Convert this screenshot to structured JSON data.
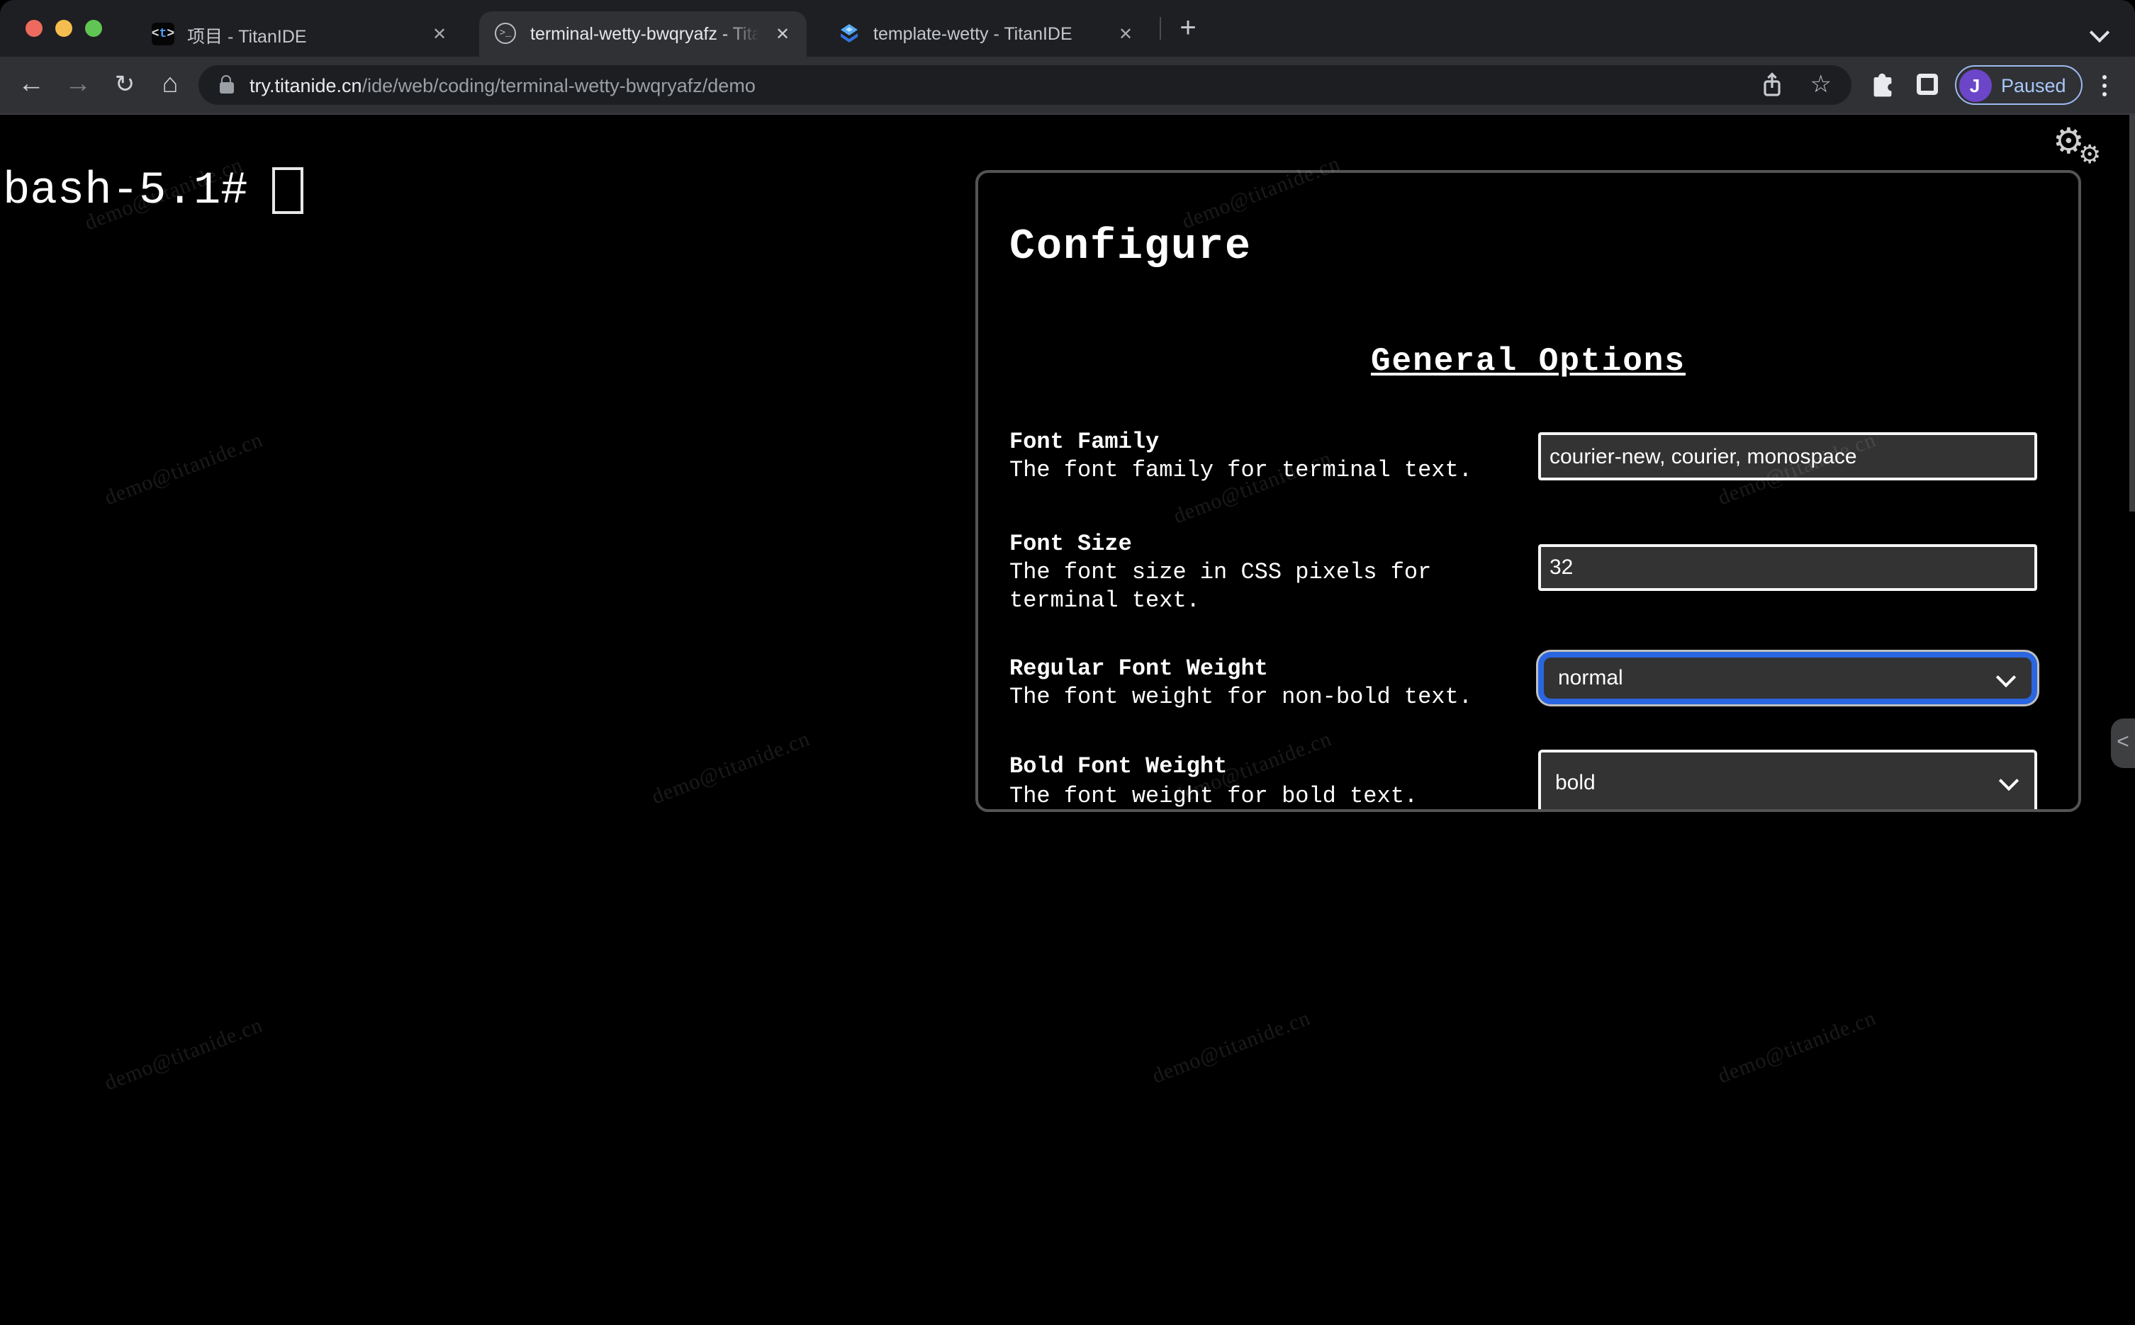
{
  "browser": {
    "tabs": [
      {
        "title": "项目 - TitanIDE",
        "active": false
      },
      {
        "title": "terminal-wetty-bwqryafz - Tita",
        "active": true
      },
      {
        "title": "template-wetty - TitanIDE",
        "active": false
      }
    ],
    "url": {
      "host": "try.titanide.cn",
      "path": "/ide/web/coding/terminal-wetty-bwqryafz/demo"
    },
    "profile": {
      "initial": "J",
      "status": "Paused"
    },
    "icons": {
      "close": "✕",
      "new_tab": "+",
      "back": "←",
      "forward": "→",
      "reload": "↻",
      "home": "⌂",
      "star": "☆",
      "gear": "⚙",
      "collapse": "<",
      "favicon_bracket_l": "<",
      "favicon_t": "t",
      "favicon_bracket_r": ">",
      "favicon_terminal": ">_"
    },
    "colors": {
      "accent_blue": "#2a66e0",
      "profile_purple": "#6b46c8",
      "paused_blue": "#a8c7fa",
      "traffic_red": "#ee6a5e",
      "traffic_yellow": "#f5bd4f",
      "traffic_green": "#61c554",
      "tabstrip_bg": "#1e1f22",
      "toolbar_bg": "#303134",
      "page_bg": "#000000"
    }
  },
  "terminal": {
    "prompt": "bash-5.1#"
  },
  "watermark": {
    "text": "demo@titanide.cn"
  },
  "configure": {
    "title": "Configure",
    "section_heading": "General Options",
    "fields": [
      {
        "label": "Font Family",
        "description": "The font family for terminal text.",
        "type": "text",
        "value": "courier-new, courier, monospace"
      },
      {
        "label": "Font Size",
        "description": "The font size in CSS pixels for terminal text.",
        "type": "text",
        "value": "32"
      },
      {
        "label": "Regular Font Weight",
        "description": "The font weight for non-bold text.",
        "type": "select",
        "value": "normal"
      },
      {
        "label": "Bold Font Weight",
        "description": "The font weight for bold text.",
        "type": "select",
        "value": "bold"
      }
    ]
  }
}
